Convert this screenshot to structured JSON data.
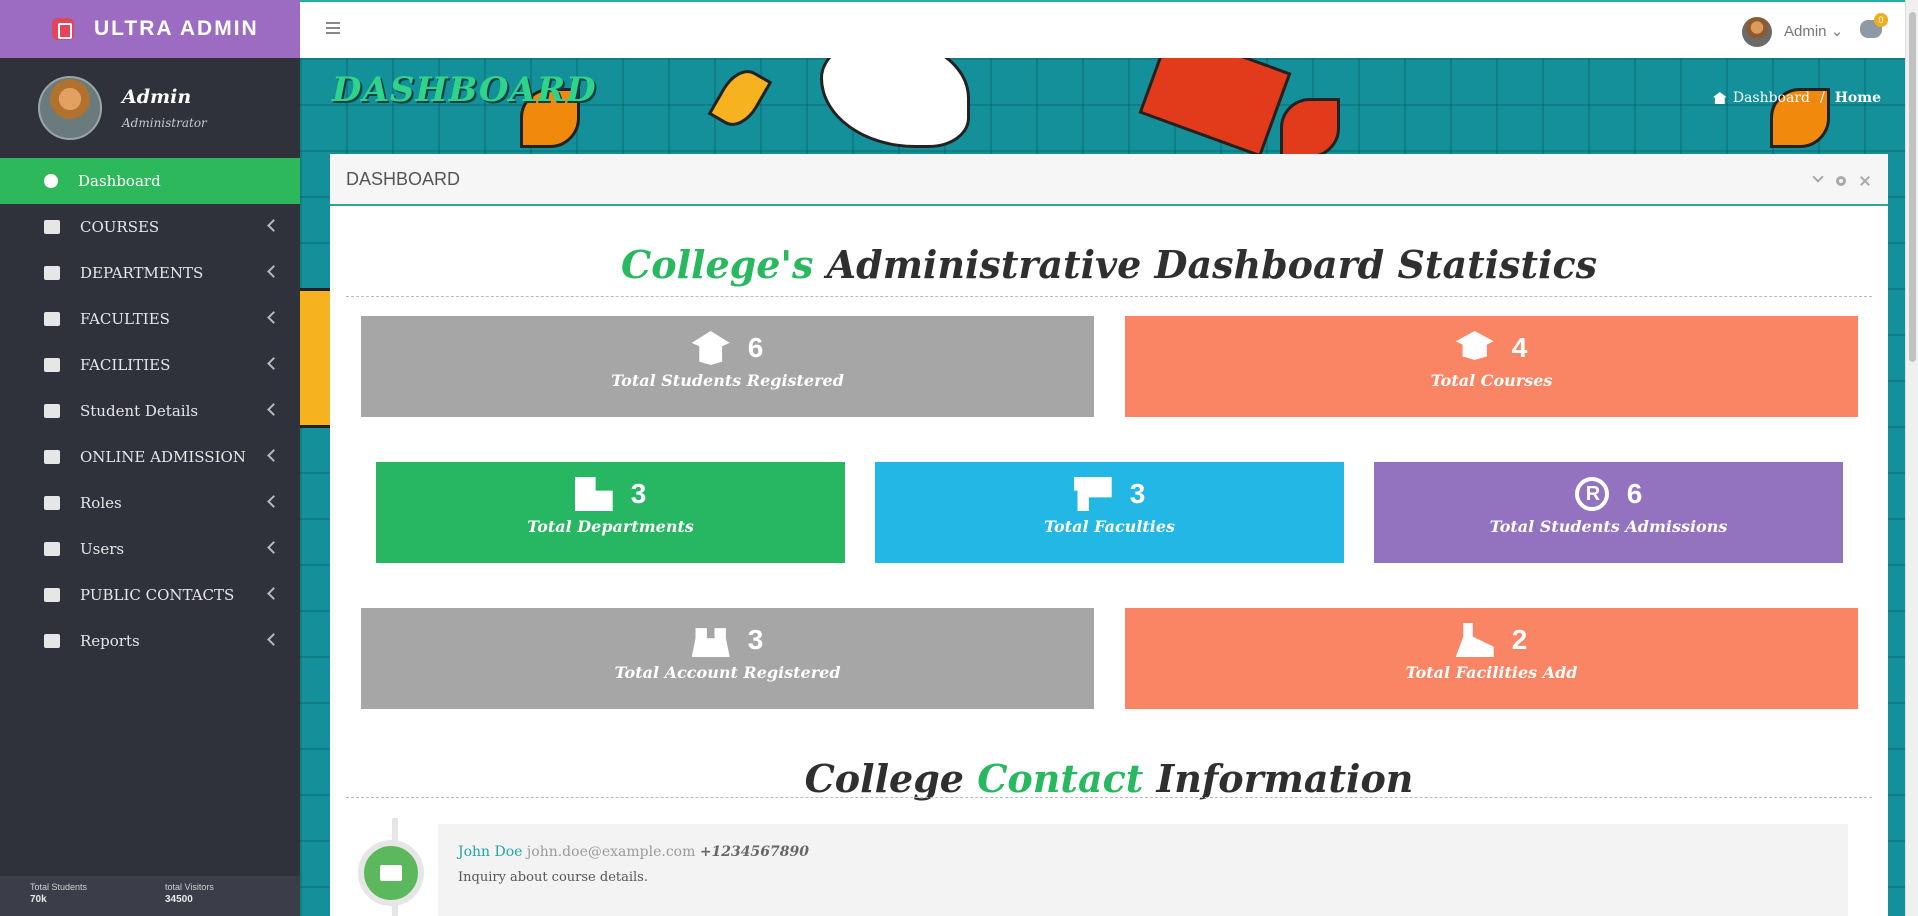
{
  "app": {
    "brand": "ULTRA ADMIN"
  },
  "profile": {
    "name": "Admin",
    "role": "Administrator"
  },
  "sidebar": {
    "items": [
      {
        "label": "Dashboard",
        "icon": "info-icon",
        "active": true
      },
      {
        "label": "COURSES",
        "icon": "book-icon"
      },
      {
        "label": "DEPARTMENTS",
        "icon": "bank-icon"
      },
      {
        "label": "FACULTIES",
        "icon": "chalkboard-icon"
      },
      {
        "label": "FACILITIES",
        "icon": "list-icon"
      },
      {
        "label": "Student Details",
        "icon": "list-icon"
      },
      {
        "label": "ONLINE ADMISSION",
        "icon": "id-card-icon"
      },
      {
        "label": "Roles",
        "icon": "user-circle-icon"
      },
      {
        "label": "Users",
        "icon": "users-icon"
      },
      {
        "label": "PUBLIC CONTACTS",
        "icon": "phone-icon"
      },
      {
        "label": "Reports",
        "icon": "chart-icon"
      }
    ],
    "footer": {
      "students_label": "Total Students",
      "students_value": "70k",
      "visitors_label": "total Visitors",
      "visitors_value": "34500"
    }
  },
  "topbar": {
    "user_name": "Admin",
    "chat_badge": "0"
  },
  "page": {
    "title": "DASHBOARD",
    "breadcrumb": {
      "home": "Dashboard",
      "sep": "/",
      "current": "Home"
    }
  },
  "panel": {
    "title": "DASHBOARD",
    "stats_heading_hl": "College's",
    "stats_heading_rest": "Administrative Dashboard Statistics",
    "contact_heading_a": "College",
    "contact_heading_hl": "Contact",
    "contact_heading_b": "Information"
  },
  "stats": [
    {
      "count": "6",
      "label": "Total Students Registered",
      "color": "#a6a6a6",
      "icon": "graduation-cap-icon"
    },
    {
      "count": "4",
      "label": "Total Courses",
      "color": "#fa8564",
      "icon": "mortarboard-icon"
    },
    {
      "count": "3",
      "label": "Total Departments",
      "color": "#27b661",
      "icon": "building-user-icon"
    },
    {
      "count": "3",
      "label": "Total Faculties",
      "color": "#23b7e5",
      "icon": "teacher-icon"
    },
    {
      "count": "6",
      "label": "Total Students Admissions",
      "color": "#9372c0",
      "icon": "registered-icon"
    },
    {
      "count": "3",
      "label": "Total Account Registered",
      "color": "#a6a6a6",
      "icon": "users-icon"
    },
    {
      "count": "2",
      "label": "Total Facilities Add",
      "color": "#fa8564",
      "icon": "digging-icon"
    }
  ],
  "contacts": [
    {
      "name": "John Doe",
      "email": "john.doe@example.com",
      "phone": "+1234567890",
      "message": "Inquiry about course details."
    }
  ]
}
